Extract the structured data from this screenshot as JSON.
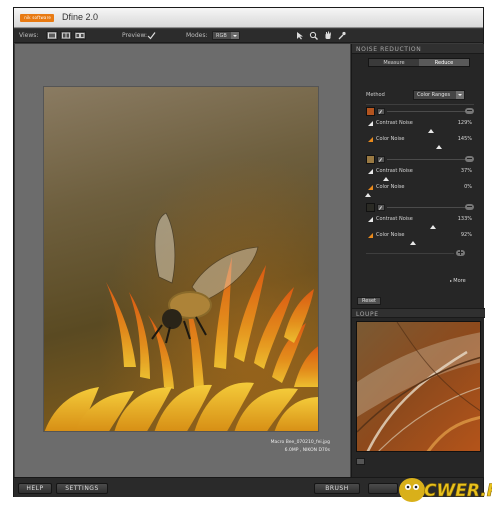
{
  "window": {
    "title": "Dfine 2.0",
    "logo_text": "nik software"
  },
  "toolbar": {
    "views_label": "Views:",
    "preview_label": "Preview:",
    "modes_label": "Modes:",
    "modes_value": "RGB",
    "icons": [
      "single-view-icon",
      "split-view-icon",
      "side-by-side-icon",
      "pointer-icon",
      "zoom-icon",
      "hand-icon",
      "eyedropper-icon"
    ]
  },
  "image": {
    "caption_name": "Macro Bee_070210_fei.jpg",
    "caption_info": "6.0MP , NIKON D70s"
  },
  "panel": {
    "header": "NOISE REDUCTION",
    "tabs": [
      {
        "label": "Measure",
        "active": false
      },
      {
        "label": "Reduce",
        "active": true
      }
    ],
    "method_label": "Method",
    "method_value": "Color Ranges",
    "groups": [
      {
        "swatch": "#b3541f",
        "contrast_label": "Contrast Noise",
        "contrast_value": "129%",
        "contrast_pos": 0.64,
        "color_label": "Color Noise",
        "color_value": "145%",
        "color_pos": 0.72
      },
      {
        "swatch": "#9a7a43",
        "contrast_label": "Contrast Noise",
        "contrast_value": "37%",
        "contrast_pos": 0.18,
        "color_label": "Color Noise",
        "color_value": "0%",
        "color_pos": 0.0
      },
      {
        "swatch": "#2a2a24",
        "contrast_label": "Contrast Noise",
        "contrast_value": "133%",
        "contrast_pos": 0.66,
        "color_label": "Color Noise",
        "color_value": "92%",
        "color_pos": 0.46
      }
    ],
    "more_label": "More",
    "reset_label": "Reset",
    "loupe_header": "LOUPE"
  },
  "bottom": {
    "help_label": "HELP",
    "settings_label": "SETTINGS",
    "brush_label": "BRUSH"
  },
  "watermark": {
    "text": "CWER.RU"
  }
}
